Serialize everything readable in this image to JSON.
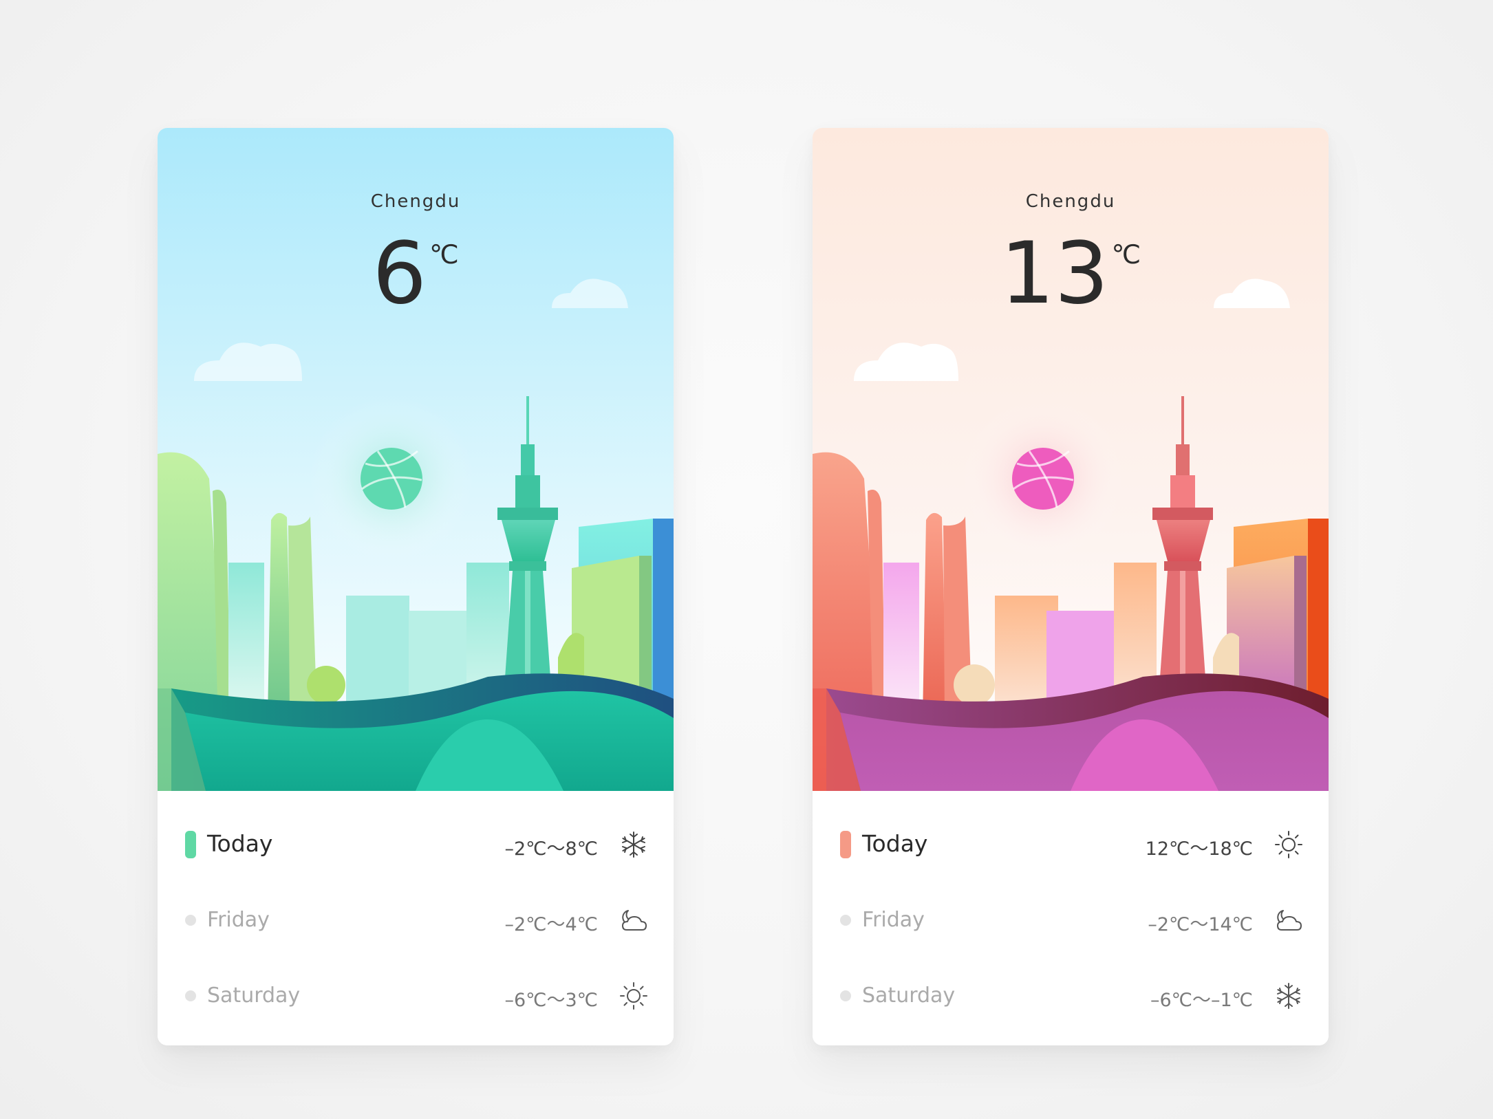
{
  "cards": [
    {
      "theme": "cool",
      "city": "Chengdu",
      "temperature": "6",
      "unit": "℃",
      "accent": "#5fd8a4",
      "ball_color": "#5ed9b0",
      "forecast": [
        {
          "day": "Today",
          "range": "–2℃～8℃",
          "icon": "snowflake-icon"
        },
        {
          "day": "Friday",
          "range": "–2℃～4℃",
          "icon": "cloudy-moon-icon"
        },
        {
          "day": "Saturday",
          "range": "–6℃～3℃",
          "icon": "sun-icon"
        }
      ]
    },
    {
      "theme": "warm",
      "city": "Chengdu",
      "temperature": "13",
      "unit": "℃",
      "accent": "#f59a86",
      "ball_color": "#ee5cbe",
      "forecast": [
        {
          "day": "Today",
          "range": "12℃～18℃",
          "icon": "sun-icon"
        },
        {
          "day": "Friday",
          "range": "–2℃～14℃",
          "icon": "cloudy-moon-icon"
        },
        {
          "day": "Saturday",
          "range": "–6℃～–1℃",
          "icon": "snowflake-icon"
        }
      ]
    }
  ]
}
